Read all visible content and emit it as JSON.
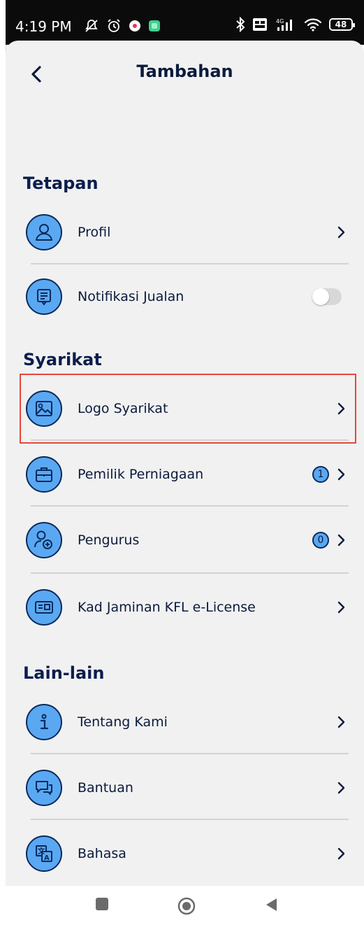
{
  "status_bar": {
    "time": "4:19 PM",
    "battery": "48",
    "icons_left": [
      "mute-icon",
      "alarm-icon",
      "app-icon-white",
      "app-icon-green"
    ],
    "icons_right": [
      "bluetooth-icon",
      "volte-icon",
      "signal-4g-icon",
      "wifi-icon",
      "battery-icon"
    ]
  },
  "header": {
    "title": "Tambahan",
    "back_icon": "chevron-left-icon"
  },
  "sections": {
    "tetapan": "Tetapan",
    "syarikat": "Syarikat",
    "lain_lain": "Lain-lain"
  },
  "items": {
    "profil": {
      "label": "Profil",
      "icon": "user-icon"
    },
    "notifikasi": {
      "label": "Notifikasi Jualan",
      "icon": "message-icon",
      "toggle_on": false
    },
    "logo": {
      "label": "Logo Syarikat",
      "icon": "image-icon"
    },
    "pemilik": {
      "label": "Pemilik Perniagaan",
      "icon": "briefcase-icon",
      "badge": "1"
    },
    "pengurus": {
      "label": "Pengurus",
      "icon": "add-user-icon",
      "badge": "0"
    },
    "kad": {
      "label": "Kad Jaminan KFL e-License",
      "icon": "id-card-icon"
    },
    "tentang": {
      "label": "Tentang Kami",
      "icon": "info-icon"
    },
    "bantuan": {
      "label": "Bantuan",
      "icon": "chat-icon"
    },
    "bahasa": {
      "label": "Bahasa",
      "icon": "translate-icon"
    }
  },
  "colors": {
    "icon_fill": "#5aa8f2",
    "icon_stroke": "#0b2a5c",
    "text": "#0b1b3d",
    "highlight": "#e8473c",
    "background": "#f1f1f1"
  }
}
